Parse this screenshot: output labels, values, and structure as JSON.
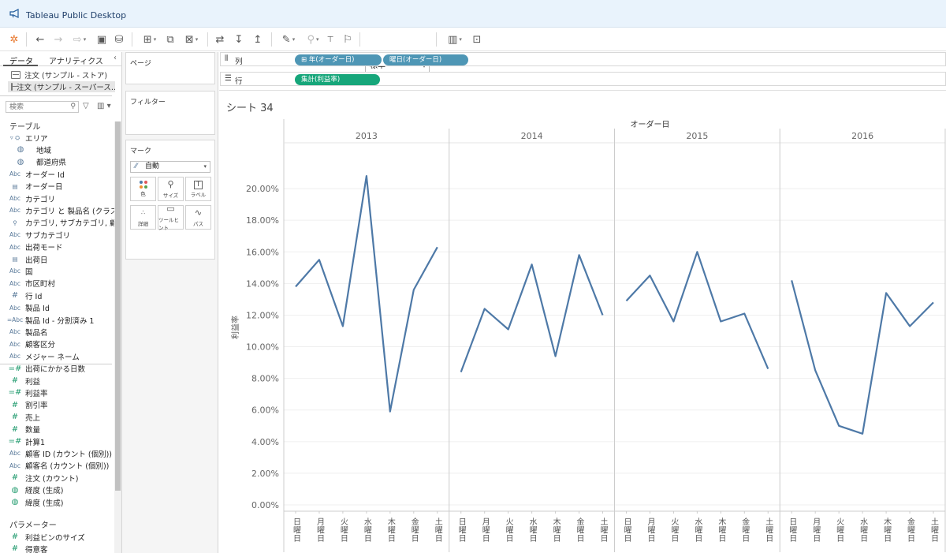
{
  "window": {
    "title": "Tableau Public Desktop"
  },
  "toolbar": {
    "font_value": "標準"
  },
  "data_pane": {
    "tabs": [
      "データ",
      "アナリティクス"
    ],
    "datasources": [
      "注文 (サンプル - ストア)",
      "注文 (サンプル - スーパース…"
    ],
    "search_placeholder": "検索",
    "tables_header": "テーブル",
    "params_header": "パラメーター",
    "fields": [
      {
        "icon": "▿ ⛭",
        "name": "エリア",
        "kind": "grp"
      },
      {
        "icon": "◍",
        "name": "地域",
        "kind": "child"
      },
      {
        "icon": "◍",
        "name": "都道府県",
        "kind": "child"
      },
      {
        "icon": "Abc",
        "name": "オーダー Id",
        "kind": "dim"
      },
      {
        "icon": "▤",
        "name": "オーダー日",
        "kind": "dim"
      },
      {
        "icon": "Abc",
        "name": "カテゴリ",
        "kind": "dim"
      },
      {
        "icon": "Abc",
        "name": "カテゴリ と 製品名 (クラス…",
        "kind": "dim"
      },
      {
        "icon": "⚲",
        "name": "カテゴリ, サブカテゴリ, 顧…",
        "kind": "dim"
      },
      {
        "icon": "Abc",
        "name": "サブカテゴリ",
        "kind": "dim"
      },
      {
        "icon": "Abc",
        "name": "出荷モード",
        "kind": "dim"
      },
      {
        "icon": "▤",
        "name": "出荷日",
        "kind": "dim"
      },
      {
        "icon": "Abc",
        "name": "国",
        "kind": "dim"
      },
      {
        "icon": "Abc",
        "name": "市区町村",
        "kind": "dim"
      },
      {
        "icon": "#",
        "name": "行 Id",
        "kind": "dimnum"
      },
      {
        "icon": "Abc",
        "name": "製品 Id",
        "kind": "dim"
      },
      {
        "icon": "=Abc",
        "name": "製品 Id - 分割済み 1",
        "kind": "dim"
      },
      {
        "icon": "Abc",
        "name": "製品名",
        "kind": "dim"
      },
      {
        "icon": "Abc",
        "name": "顧客区分",
        "kind": "dim"
      },
      {
        "icon": "Abc",
        "name": "メジャー ネーム",
        "kind": "dim"
      },
      {
        "icon": "=#",
        "name": "出荷にかかる日数",
        "kind": "meas"
      },
      {
        "icon": "#",
        "name": "利益",
        "kind": "meas"
      },
      {
        "icon": "=#",
        "name": "利益率",
        "kind": "meas"
      },
      {
        "icon": "#",
        "name": "割引率",
        "kind": "meas"
      },
      {
        "icon": "#",
        "name": "売上",
        "kind": "meas"
      },
      {
        "icon": "#",
        "name": "数量",
        "kind": "meas"
      },
      {
        "icon": "=#",
        "name": "計算1",
        "kind": "meas"
      },
      {
        "icon": "Abc",
        "name": "顧客 ID (カウント (個別))",
        "kind": "dim"
      },
      {
        "icon": "Abc",
        "name": "顧客名 (カウント (個別))",
        "kind": "dim"
      },
      {
        "icon": "#",
        "name": "注文 (カウント)",
        "kind": "meas"
      },
      {
        "icon": "◍",
        "name": "経度 (生成)",
        "kind": "meas"
      },
      {
        "icon": "◍",
        "name": "緯度 (生成)",
        "kind": "meas"
      }
    ],
    "params": [
      {
        "icon": "#",
        "name": "利益ビンのサイズ"
      },
      {
        "icon": "#",
        "name": "得意客"
      }
    ]
  },
  "cards": {
    "pages_label": "ページ",
    "filters_label": "フィルター",
    "marks_label": "マーク",
    "marks_type": "自動",
    "mark_buttons": [
      "色",
      "サイズ",
      "ラベル",
      "詳細",
      "ツールヒント",
      "パス"
    ]
  },
  "shelves": {
    "columns_label": "列",
    "rows_label": "行",
    "column_pills": [
      "⊞ 年(オーダー日)",
      "曜日(オーダー日)"
    ],
    "row_pills": [
      "集計(利益率)"
    ]
  },
  "sheet": {
    "title": "シート 34"
  },
  "chart_data": {
    "type": "line",
    "title": "",
    "header": "オーダー日",
    "ylabel": "利益率",
    "ylim": [
      0,
      0.22
    ],
    "yticks": [
      "0.00%",
      "2.00%",
      "4.00%",
      "6.00%",
      "8.00%",
      "10.00%",
      "12.00%",
      "14.00%",
      "16.00%",
      "18.00%",
      "20.00%"
    ],
    "categories": [
      "日曜日",
      "月曜日",
      "火曜日",
      "水曜日",
      "木曜日",
      "金曜日",
      "土曜日"
    ],
    "series": [
      {
        "name": "2013",
        "values": [
          0.138,
          0.155,
          0.113,
          0.208,
          0.059,
          0.136,
          0.163
        ]
      },
      {
        "name": "2014",
        "values": [
          0.084,
          0.124,
          0.111,
          0.152,
          0.094,
          0.158,
          0.12
        ]
      },
      {
        "name": "2015",
        "values": [
          0.129,
          0.145,
          0.116,
          0.16,
          0.116,
          0.121,
          0.086
        ]
      },
      {
        "name": "2016",
        "values": [
          0.142,
          0.085,
          0.05,
          0.045,
          0.134,
          0.113,
          0.128
        ]
      }
    ],
    "line_color": "#4e79a7",
    "grid": true
  }
}
